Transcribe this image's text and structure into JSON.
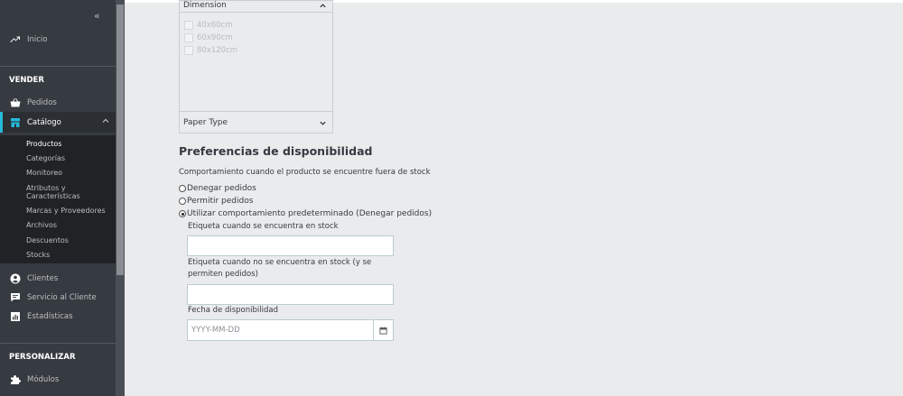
{
  "sidebar": {
    "collapse_label": "«",
    "inicio": "Inicio",
    "vender_title": "VENDER",
    "pedidos": "Pedidos",
    "catalogo": "Catálogo",
    "catalog_items": [
      "Productos",
      "Categorías",
      "Monitoreo",
      "Atributos y Características",
      "Marcas y Proveedores",
      "Archivos",
      "Descuentos",
      "Stocks"
    ],
    "clientes": "Clientes",
    "servicio": "Servicio al Cliente",
    "estadisticas": "Estadísticas",
    "personalizar_title": "PERSONALIZAR",
    "modulos": "Módulos",
    "accent_color": "#25b9d7"
  },
  "filters": {
    "dimension_title": "Dimension",
    "dimension_options": [
      "40x60cm",
      "60x90cm",
      "80x120cm"
    ],
    "paper_type_title": "Paper Type"
  },
  "availability": {
    "title": "Preferencias de disponibilidad",
    "behavior_label": "Comportamiento cuando el producto se encuentre fuera de stock",
    "options": [
      "Denegar pedidos",
      "Permitir pedidos",
      "Utilizar comportamiento predeterminado (Denegar pedidos)"
    ],
    "selected_index": 2,
    "in_stock_label": "Etiqueta cuando se encuentra en stock",
    "out_stock_label_line1": "Etiqueta cuando no se encuentra en stock (y se",
    "out_stock_label_line2": "permiten pedidos)",
    "date_label": "Fecha de disponibilidad",
    "date_placeholder": "YYYY-MM-DD"
  }
}
